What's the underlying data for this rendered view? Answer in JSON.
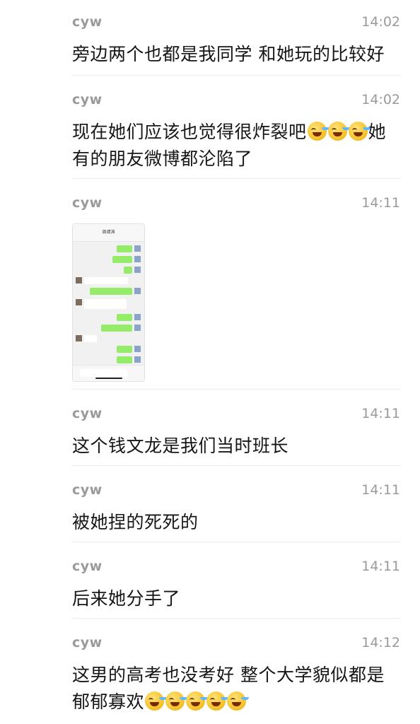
{
  "messages": [
    {
      "sender": "cyw",
      "time": "14:02",
      "text": "旁边两个也都是我同学 和她玩的比较好"
    },
    {
      "sender": "cyw",
      "time": "14:02",
      "line1": "现在她们应该也觉得很炸裂吧",
      "line1_tail": "她",
      "line2": "有的朋友微博都沦陷了",
      "emoji": "face-with-tears-of-joy"
    },
    {
      "sender": "cyw",
      "time": "14:11",
      "image": "chat-screenshot-thumbnail",
      "image_title": "周靖涛"
    },
    {
      "sender": "cyw",
      "time": "14:11",
      "text": "这个钱文龙是我们当时班长"
    },
    {
      "sender": "cyw",
      "time": "14:11",
      "text": "被她捏的死死的"
    },
    {
      "sender": "cyw",
      "time": "14:11",
      "text": "后来她分手了"
    },
    {
      "sender": "cyw",
      "time": "14:12",
      "line1": "这男的高考也没考好 整个大学貌似都是",
      "line2": "郁郁寡欢",
      "emoji": "face-with-tears-of-joy"
    }
  ]
}
